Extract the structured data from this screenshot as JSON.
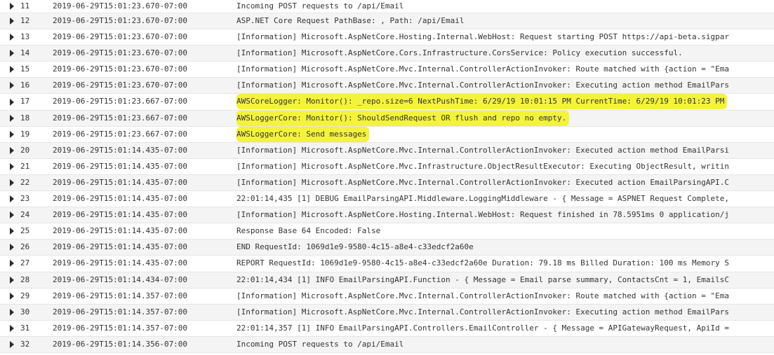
{
  "colors": {
    "highlight": "#f3f33a",
    "row_alt": "#f4f4f4",
    "divider": "#e6e6e6",
    "text": "#333333"
  },
  "rows": [
    {
      "index": "11",
      "timestamp": "2019-06-29T15:01:23.670-07:00",
      "message": "Incoming POST requests to /api/Email",
      "highlighted": false
    },
    {
      "index": "12",
      "timestamp": "2019-06-29T15:01:23.670-07:00",
      "message": "ASP.NET Core Request PathBase: , Path: /api/Email",
      "highlighted": false
    },
    {
      "index": "13",
      "timestamp": "2019-06-29T15:01:23.670-07:00",
      "message": "[Information] Microsoft.AspNetCore.Hosting.Internal.WebHost: Request starting POST https://api-beta.sigpar",
      "highlighted": false
    },
    {
      "index": "14",
      "timestamp": "2019-06-29T15:01:23.670-07:00",
      "message": "[Information] Microsoft.AspNetCore.Cors.Infrastructure.CorsService: Policy execution successful.",
      "highlighted": false
    },
    {
      "index": "15",
      "timestamp": "2019-06-29T15:01:23.670-07:00",
      "message": "[Information] Microsoft.AspNetCore.Mvc.Internal.ControllerActionInvoker: Route matched with {action = \"Ema",
      "highlighted": false
    },
    {
      "index": "16",
      "timestamp": "2019-06-29T15:01:23.670-07:00",
      "message": "[Information] Microsoft.AspNetCore.Mvc.Internal.ControllerActionInvoker: Executing action method EmailPars",
      "highlighted": false
    },
    {
      "index": "17",
      "timestamp": "2019-06-29T15:01:23.667-07:00",
      "message": "AWSCoreLogger: Monitor(): _repo.size=6 NextPushTime: 6/29/19 10:01:15 PM CurrentTime: 6/29/19 10:01:23 PM",
      "highlighted": true
    },
    {
      "index": "18",
      "timestamp": "2019-06-29T15:01:23.667-07:00",
      "message": "AWSLoggerCore: Monitor(): ShouldSendRequest OR flush and repo no empty.",
      "highlighted": true
    },
    {
      "index": "19",
      "timestamp": "2019-06-29T15:01:23.667-07:00",
      "message": "AWSLoggerCore: Send messages",
      "highlighted": true
    },
    {
      "index": "20",
      "timestamp": "2019-06-29T15:01:14.435-07:00",
      "message": "[Information] Microsoft.AspNetCore.Mvc.Internal.ControllerActionInvoker: Executed action method EmailParsi",
      "highlighted": false
    },
    {
      "index": "21",
      "timestamp": "2019-06-29T15:01:14.435-07:00",
      "message": "[Information] Microsoft.AspNetCore.Mvc.Infrastructure.ObjectResultExecutor: Executing ObjectResult, writin",
      "highlighted": false
    },
    {
      "index": "22",
      "timestamp": "2019-06-29T15:01:14.435-07:00",
      "message": "[Information] Microsoft.AspNetCore.Mvc.Internal.ControllerActionInvoker: Executed action EmailParsingAPI.C",
      "highlighted": false
    },
    {
      "index": "23",
      "timestamp": "2019-06-29T15:01:14.435-07:00",
      "message": "22:01:14,435 [1] DEBUG EmailParsingAPI.Middleware.LoggingMiddleware - { Message = ASPNET Request Complete,",
      "highlighted": false
    },
    {
      "index": "24",
      "timestamp": "2019-06-29T15:01:14.435-07:00",
      "message": "[Information] Microsoft.AspNetCore.Hosting.Internal.WebHost: Request finished in 78.5951ms 0 application/j",
      "highlighted": false
    },
    {
      "index": "25",
      "timestamp": "2019-06-29T15:01:14.435-07:00",
      "message": "Response Base 64 Encoded: False",
      "highlighted": false
    },
    {
      "index": "26",
      "timestamp": "2019-06-29T15:01:14.435-07:00",
      "message": "END RequestId: 1069d1e9-9580-4c15-a8e4-c33edcf2a60e",
      "highlighted": false
    },
    {
      "index": "27",
      "timestamp": "2019-06-29T15:01:14.435-07:00",
      "message": "REPORT RequestId: 1069d1e9-9580-4c15-a8e4-c33edcf2a60e Duration: 79.18 ms Billed Duration: 100 ms Memory S",
      "highlighted": false
    },
    {
      "index": "28",
      "timestamp": "2019-06-29T15:01:14.434-07:00",
      "message": "22:01:14,434 [1] INFO EmailParsingAPI.Function - { Message = Email parse summary, ContactsCnt = 1, EmailsC",
      "highlighted": false
    },
    {
      "index": "29",
      "timestamp": "2019-06-29T15:01:14.357-07:00",
      "message": "[Information] Microsoft.AspNetCore.Mvc.Internal.ControllerActionInvoker: Route matched with {action = \"Ema",
      "highlighted": false
    },
    {
      "index": "30",
      "timestamp": "2019-06-29T15:01:14.357-07:00",
      "message": "[Information] Microsoft.AspNetCore.Mvc.Internal.ControllerActionInvoker: Executing action method EmailPars",
      "highlighted": false
    },
    {
      "index": "31",
      "timestamp": "2019-06-29T15:01:14.357-07:00",
      "message": "22:01:14,357 [1] INFO EmailParsingAPI.Controllers.EmailController - { Message = APIGatewayRequest, ApiId =",
      "highlighted": false
    },
    {
      "index": "32",
      "timestamp": "2019-06-29T15:01:14.356-07:00",
      "message": "Incoming POST requests to /api/Email",
      "highlighted": false
    }
  ]
}
